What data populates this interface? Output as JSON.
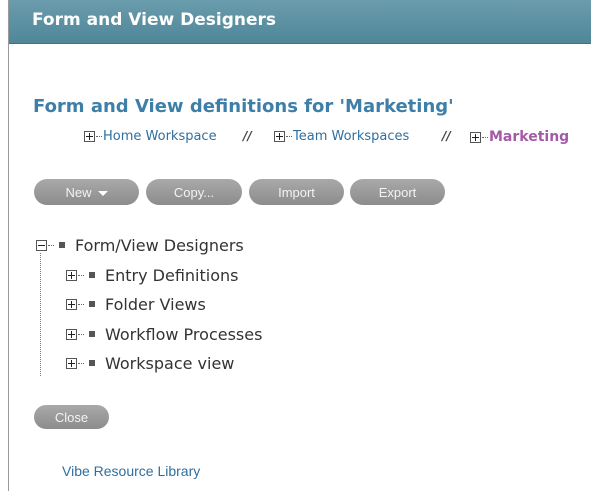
{
  "header": {
    "title": "Form and View Designers"
  },
  "page_title": "Form and View definitions for 'Marketing'",
  "breadcrumb": {
    "items": [
      {
        "label": "Home Workspace",
        "current": false
      },
      {
        "label": "Team Workspaces",
        "current": false
      },
      {
        "label": "Marketing",
        "current": true
      }
    ],
    "separator": "//"
  },
  "toolbar": {
    "new_label": "New",
    "copy_label": "Copy...",
    "import_label": "Import",
    "export_label": "Export"
  },
  "tree": {
    "root_label": "Form/View Designers",
    "children": [
      {
        "label": "Entry Definitions"
      },
      {
        "label": "Folder Views"
      },
      {
        "label": "Workflow Processes"
      },
      {
        "label": "Workspace view"
      }
    ]
  },
  "close_label": "Close",
  "footer_link": "Vibe Resource Library"
}
